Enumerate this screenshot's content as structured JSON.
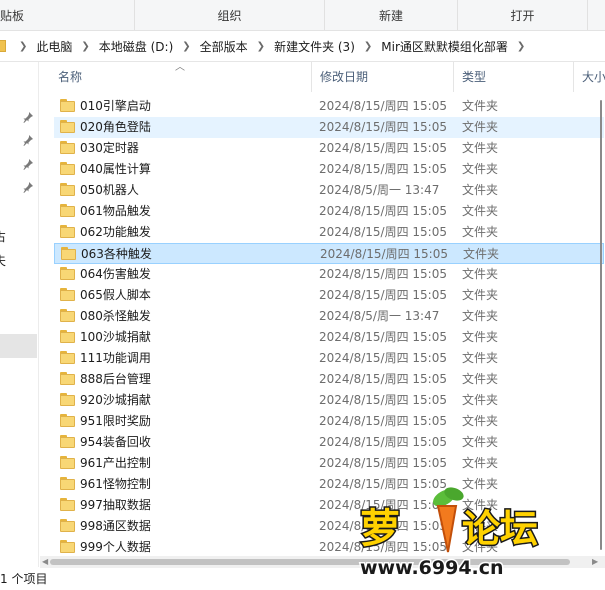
{
  "ribbon": {
    "groups": [
      "贴板",
      "组织",
      "新建",
      "打开"
    ]
  },
  "address": {
    "crumbs": [
      "此电脑",
      "本地磁盘 (D:)",
      "全部版本",
      "新建文件夹 (3)",
      "Mir通区默默模组化部署"
    ]
  },
  "nav": {
    "fragments": [
      "占",
      "夫"
    ]
  },
  "columns": {
    "name": "名称",
    "date": "修改日期",
    "type": "类型",
    "size": "大小"
  },
  "files": [
    {
      "name": "010引擎启动",
      "date": "2024/8/15/周四 15:05",
      "type": "文件夹"
    },
    {
      "name": "020角色登陆",
      "date": "2024/8/15/周四 15:05",
      "type": "文件夹"
    },
    {
      "name": "030定时器",
      "date": "2024/8/15/周四 15:05",
      "type": "文件夹"
    },
    {
      "name": "040属性计算",
      "date": "2024/8/15/周四 15:05",
      "type": "文件夹"
    },
    {
      "name": "050机器人",
      "date": "2024/8/5/周一 13:47",
      "type": "文件夹"
    },
    {
      "name": "061物品触发",
      "date": "2024/8/15/周四 15:05",
      "type": "文件夹"
    },
    {
      "name": "062功能触发",
      "date": "2024/8/15/周四 15:05",
      "type": "文件夹"
    },
    {
      "name": "063各种触发",
      "date": "2024/8/15/周四 15:05",
      "type": "文件夹"
    },
    {
      "name": "064伤害触发",
      "date": "2024/8/15/周四 15:05",
      "type": "文件夹"
    },
    {
      "name": "065假人脚本",
      "date": "2024/8/15/周四 15:05",
      "type": "文件夹"
    },
    {
      "name": "080杀怪触发",
      "date": "2024/8/5/周一 13:47",
      "type": "文件夹"
    },
    {
      "name": "100沙城捐献",
      "date": "2024/8/15/周四 15:05",
      "type": "文件夹"
    },
    {
      "name": "111功能调用",
      "date": "2024/8/15/周四 15:05",
      "type": "文件夹"
    },
    {
      "name": "888后台管理",
      "date": "2024/8/15/周四 15:05",
      "type": "文件夹"
    },
    {
      "name": "920沙城捐献",
      "date": "2024/8/15/周四 15:05",
      "type": "文件夹"
    },
    {
      "name": "951限时奖励",
      "date": "2024/8/15/周四 15:05",
      "type": "文件夹"
    },
    {
      "name": "954装备回收",
      "date": "2024/8/15/周四 15:05",
      "type": "文件夹"
    },
    {
      "name": "961产出控制",
      "date": "2024/8/15/周四 15:05",
      "type": "文件夹"
    },
    {
      "name": "961怪物控制",
      "date": "2024/8/15/周四 15:05",
      "type": "文件夹"
    },
    {
      "name": "997抽取数据",
      "date": "2024/8/15/周四 15:05",
      "type": "文件夹"
    },
    {
      "name": "998通区数据",
      "date": "2024/8/15/周四 15:05",
      "type": "文件夹"
    },
    {
      "name": "999个人数据",
      "date": "2024/8/15/周四 15:05",
      "type": "文件夹"
    }
  ],
  "hover_index": 1,
  "selected_index": 7,
  "status": {
    "text": "1 个项目"
  },
  "watermark": {
    "brand": "萝卜论坛",
    "url": "www.6994.cn"
  },
  "colors": {
    "selected_bg": "#cce8ff",
    "hover_bg": "#e5f3ff",
    "folder": "#f8d775"
  }
}
